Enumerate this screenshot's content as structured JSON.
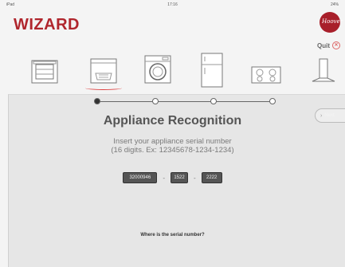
{
  "status_bar": {
    "carrier": "iPad",
    "time": "17:16",
    "battery": "24%"
  },
  "header": {
    "logo_text": "WIZARD",
    "brand_name": "Hoover",
    "quit_label": "Quit"
  },
  "appliances": [
    {
      "name": "oven",
      "selected": false
    },
    {
      "name": "dishwasher",
      "selected": true
    },
    {
      "name": "washing-machine",
      "selected": false
    },
    {
      "name": "fridge",
      "selected": false
    },
    {
      "name": "hob",
      "selected": false
    },
    {
      "name": "hood",
      "selected": false
    }
  ],
  "progress": {
    "total_steps": 4,
    "current_step": 1
  },
  "next_label": "Next",
  "main": {
    "title": "Appliance Recognition",
    "instruction_line1": "Insert your appliance serial number",
    "instruction_line2": "(16 digits. Ex: 12345678-1234-1234)",
    "serial": {
      "part1": "32000946",
      "part2": "1522",
      "part3": "2222",
      "separator": "-"
    },
    "help_link": "Where is the serial number?"
  },
  "colors": {
    "accent": "#b0262d",
    "field_bg": "#555555",
    "background": "#f4f4f4"
  }
}
